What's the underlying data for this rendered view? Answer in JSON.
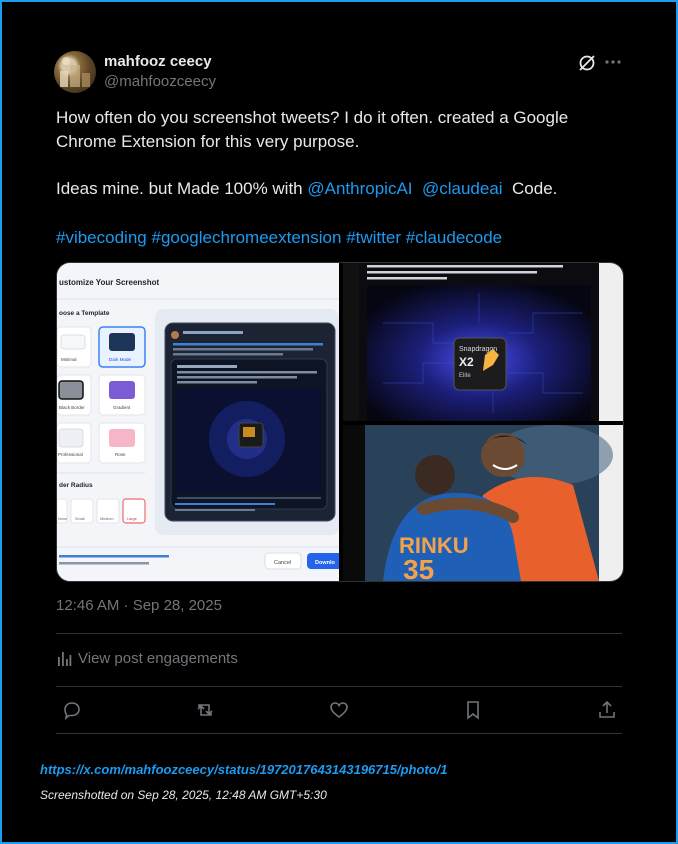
{
  "author": {
    "name": "mahfooz ceecy",
    "handle": "@mahfoozceecy"
  },
  "post": {
    "line1": "How often do you screenshot tweets? I do it often. created a Google",
    "line2": "Chrome Extension for this very purpose.",
    "line3_prefix": "Ideas mine. but Made 100% with ",
    "mention1": "@AnthropicAI",
    "mention2": "@claudeai",
    "line3_suffix": "Code.",
    "hashtags": [
      "#vibecoding",
      "#googlechromeextension",
      "#twitter",
      "#claudecode"
    ]
  },
  "media": {
    "left_title": "ustomize Your Screenshot",
    "left_section": "oose a Template",
    "templates": [
      "Minimal",
      "Dark Mode",
      "Black Border",
      "Gradient",
      "Professional",
      "Rose"
    ],
    "radius_label": "der Radius",
    "radius_options": [
      "None",
      "Small",
      "Medium",
      "Large"
    ],
    "cancel_label": "Cancel",
    "download_label": "Downlo",
    "chip_brand": "Snapdragon",
    "chip_model": "X2",
    "chip_sub": "Elite",
    "jersey_text": "RINKU",
    "jersey_number": "35"
  },
  "timestamp": "12:46 AM · Sep 28, 2025",
  "engagements_label": "View post engagements",
  "footer": {
    "url": "https://x.com/mahfoozceecy/status/1972017643143196715/photo/1",
    "note": "Screenshotted on Sep 28, 2025, 12:48 AM GMT+5:30"
  },
  "colors": {
    "accent": "#1d9bf0",
    "text": "#e7e9ea",
    "muted": "#71767b",
    "border": "#2f3336"
  }
}
